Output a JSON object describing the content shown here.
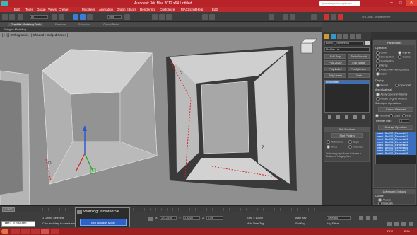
{
  "window": {
    "title": "Autodesk 3ds Max  2012 x64       Untitled",
    "search_placeholder": "Type a keyword or phrase",
    "user": "SPL Align - otrawmemme"
  },
  "menu": [
    "Edit",
    "Tools",
    "Group",
    "Views",
    "Create",
    "Modifiers",
    "Animation",
    "Graph Editors",
    "Rendering",
    "Customize",
    "MAXScript",
    "Help",
    "Ed2"
  ],
  "toolbar": {
    "filter": "All",
    "view": "View",
    "coord": "2.5"
  },
  "ribbon": {
    "tabs": [
      "Graphite Modeling Tools",
      "Freeform",
      "Selection",
      "Object Paint"
    ],
    "sub": "Polygon Modeling"
  },
  "viewport": {
    "label": "[ + ] [ Orthographic ] [ Shaded + Edged Faces ]"
  },
  "modifier": {
    "object_name": "Box001_Elements01",
    "list_label": "Modifier List",
    "buttons": [
      "Edit Poly",
      "TurboSmooth",
      "Poly 2x2x2",
      "Edit Spline",
      "Poly 2x2x2",
      "ProOptimizer",
      "Poly Vertex",
      "Push"
    ],
    "stack_item": "ProBoolean",
    "pick_title": "Pick Boolean",
    "start_picking": "Start Picking",
    "pick_opts": [
      "Reference",
      "Copy",
      "Move",
      "Instance"
    ],
    "credit": "Technology by nPower Software a Division of IntegrityWare"
  },
  "parameters": {
    "title": "Parameters",
    "operation_label": "Operation",
    "operations": [
      "Union",
      "Imprint",
      "Intersection",
      "Cookie",
      "Subtraction",
      "Merge",
      "Attach (No Intersections)",
      "Insert"
    ],
    "display_label": "Display",
    "display_opts": [
      "Result",
      "Operands"
    ],
    "material_label": "Apply Material",
    "material_opts": [
      "Apply Operand Material",
      "Retain Original Material"
    ],
    "subobj_label": "Sub-object Operations",
    "extract_btn": "Extract Selected",
    "remove_opts": [
      "Remove",
      "Copy",
      "Inst"
    ],
    "reorder_label": "Reorder Ops:",
    "reorder_value": "0",
    "change_op": "Change Operation",
    "ops_list": [
      "Insert - Box001_Elements01",
      "Insert - Box001_Elements02",
      "Insert - Box001_Elements03",
      "Insert - Box001_Elements04",
      "Insert - Box001_Elements05",
      "Insert - Box001_Elements06",
      "Insert - Box001_Elements07",
      "Insert - Box001_Elements08"
    ],
    "adv_title": "Advanced Options",
    "update_label": "Update",
    "update_opts": [
      "Always",
      "Manually"
    ]
  },
  "timeline": {
    "frame": "0 / 100"
  },
  "status": {
    "selection": "1 Object Selected",
    "prompt": "Click and drag to select and move objects",
    "x": "121.241in",
    "y": "1.524in",
    "z": "0.0in",
    "grid": "Grid = 10.0in",
    "autokey": "Auto Key",
    "setkey": "Set Key",
    "selected": "Selected",
    "filters": "Key Filters...",
    "addtime": "Add Time Tag",
    "time_label": "Time:",
    "time_value": "0.555sec"
  },
  "popup": {
    "title": "Warning: Isolated Se...",
    "exit": "Exit Isolation Mode"
  },
  "taskbar": {
    "lang": "РУС",
    "clock": "2:00"
  }
}
